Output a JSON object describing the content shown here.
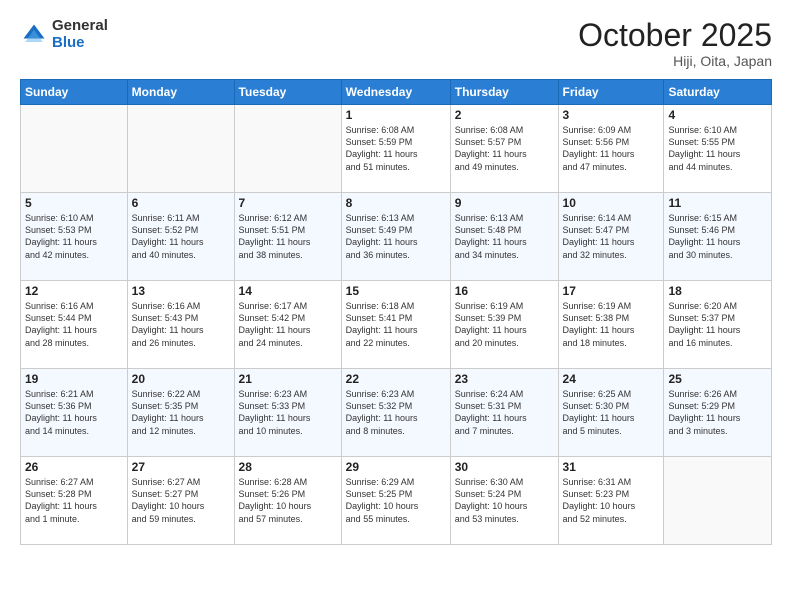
{
  "logo": {
    "general": "General",
    "blue": "Blue"
  },
  "header": {
    "month": "October 2025",
    "location": "Hiji, Oita, Japan"
  },
  "days_of_week": [
    "Sunday",
    "Monday",
    "Tuesday",
    "Wednesday",
    "Thursday",
    "Friday",
    "Saturday"
  ],
  "weeks": [
    [
      {
        "day": "",
        "info": ""
      },
      {
        "day": "",
        "info": ""
      },
      {
        "day": "",
        "info": ""
      },
      {
        "day": "1",
        "info": "Sunrise: 6:08 AM\nSunset: 5:59 PM\nDaylight: 11 hours\nand 51 minutes."
      },
      {
        "day": "2",
        "info": "Sunrise: 6:08 AM\nSunset: 5:57 PM\nDaylight: 11 hours\nand 49 minutes."
      },
      {
        "day": "3",
        "info": "Sunrise: 6:09 AM\nSunset: 5:56 PM\nDaylight: 11 hours\nand 47 minutes."
      },
      {
        "day": "4",
        "info": "Sunrise: 6:10 AM\nSunset: 5:55 PM\nDaylight: 11 hours\nand 44 minutes."
      }
    ],
    [
      {
        "day": "5",
        "info": "Sunrise: 6:10 AM\nSunset: 5:53 PM\nDaylight: 11 hours\nand 42 minutes."
      },
      {
        "day": "6",
        "info": "Sunrise: 6:11 AM\nSunset: 5:52 PM\nDaylight: 11 hours\nand 40 minutes."
      },
      {
        "day": "7",
        "info": "Sunrise: 6:12 AM\nSunset: 5:51 PM\nDaylight: 11 hours\nand 38 minutes."
      },
      {
        "day": "8",
        "info": "Sunrise: 6:13 AM\nSunset: 5:49 PM\nDaylight: 11 hours\nand 36 minutes."
      },
      {
        "day": "9",
        "info": "Sunrise: 6:13 AM\nSunset: 5:48 PM\nDaylight: 11 hours\nand 34 minutes."
      },
      {
        "day": "10",
        "info": "Sunrise: 6:14 AM\nSunset: 5:47 PM\nDaylight: 11 hours\nand 32 minutes."
      },
      {
        "day": "11",
        "info": "Sunrise: 6:15 AM\nSunset: 5:46 PM\nDaylight: 11 hours\nand 30 minutes."
      }
    ],
    [
      {
        "day": "12",
        "info": "Sunrise: 6:16 AM\nSunset: 5:44 PM\nDaylight: 11 hours\nand 28 minutes."
      },
      {
        "day": "13",
        "info": "Sunrise: 6:16 AM\nSunset: 5:43 PM\nDaylight: 11 hours\nand 26 minutes."
      },
      {
        "day": "14",
        "info": "Sunrise: 6:17 AM\nSunset: 5:42 PM\nDaylight: 11 hours\nand 24 minutes."
      },
      {
        "day": "15",
        "info": "Sunrise: 6:18 AM\nSunset: 5:41 PM\nDaylight: 11 hours\nand 22 minutes."
      },
      {
        "day": "16",
        "info": "Sunrise: 6:19 AM\nSunset: 5:39 PM\nDaylight: 11 hours\nand 20 minutes."
      },
      {
        "day": "17",
        "info": "Sunrise: 6:19 AM\nSunset: 5:38 PM\nDaylight: 11 hours\nand 18 minutes."
      },
      {
        "day": "18",
        "info": "Sunrise: 6:20 AM\nSunset: 5:37 PM\nDaylight: 11 hours\nand 16 minutes."
      }
    ],
    [
      {
        "day": "19",
        "info": "Sunrise: 6:21 AM\nSunset: 5:36 PM\nDaylight: 11 hours\nand 14 minutes."
      },
      {
        "day": "20",
        "info": "Sunrise: 6:22 AM\nSunset: 5:35 PM\nDaylight: 11 hours\nand 12 minutes."
      },
      {
        "day": "21",
        "info": "Sunrise: 6:23 AM\nSunset: 5:33 PM\nDaylight: 11 hours\nand 10 minutes."
      },
      {
        "day": "22",
        "info": "Sunrise: 6:23 AM\nSunset: 5:32 PM\nDaylight: 11 hours\nand 8 minutes."
      },
      {
        "day": "23",
        "info": "Sunrise: 6:24 AM\nSunset: 5:31 PM\nDaylight: 11 hours\nand 7 minutes."
      },
      {
        "day": "24",
        "info": "Sunrise: 6:25 AM\nSunset: 5:30 PM\nDaylight: 11 hours\nand 5 minutes."
      },
      {
        "day": "25",
        "info": "Sunrise: 6:26 AM\nSunset: 5:29 PM\nDaylight: 11 hours\nand 3 minutes."
      }
    ],
    [
      {
        "day": "26",
        "info": "Sunrise: 6:27 AM\nSunset: 5:28 PM\nDaylight: 11 hours\nand 1 minute."
      },
      {
        "day": "27",
        "info": "Sunrise: 6:27 AM\nSunset: 5:27 PM\nDaylight: 10 hours\nand 59 minutes."
      },
      {
        "day": "28",
        "info": "Sunrise: 6:28 AM\nSunset: 5:26 PM\nDaylight: 10 hours\nand 57 minutes."
      },
      {
        "day": "29",
        "info": "Sunrise: 6:29 AM\nSunset: 5:25 PM\nDaylight: 10 hours\nand 55 minutes."
      },
      {
        "day": "30",
        "info": "Sunrise: 6:30 AM\nSunset: 5:24 PM\nDaylight: 10 hours\nand 53 minutes."
      },
      {
        "day": "31",
        "info": "Sunrise: 6:31 AM\nSunset: 5:23 PM\nDaylight: 10 hours\nand 52 minutes."
      },
      {
        "day": "",
        "info": ""
      }
    ]
  ]
}
